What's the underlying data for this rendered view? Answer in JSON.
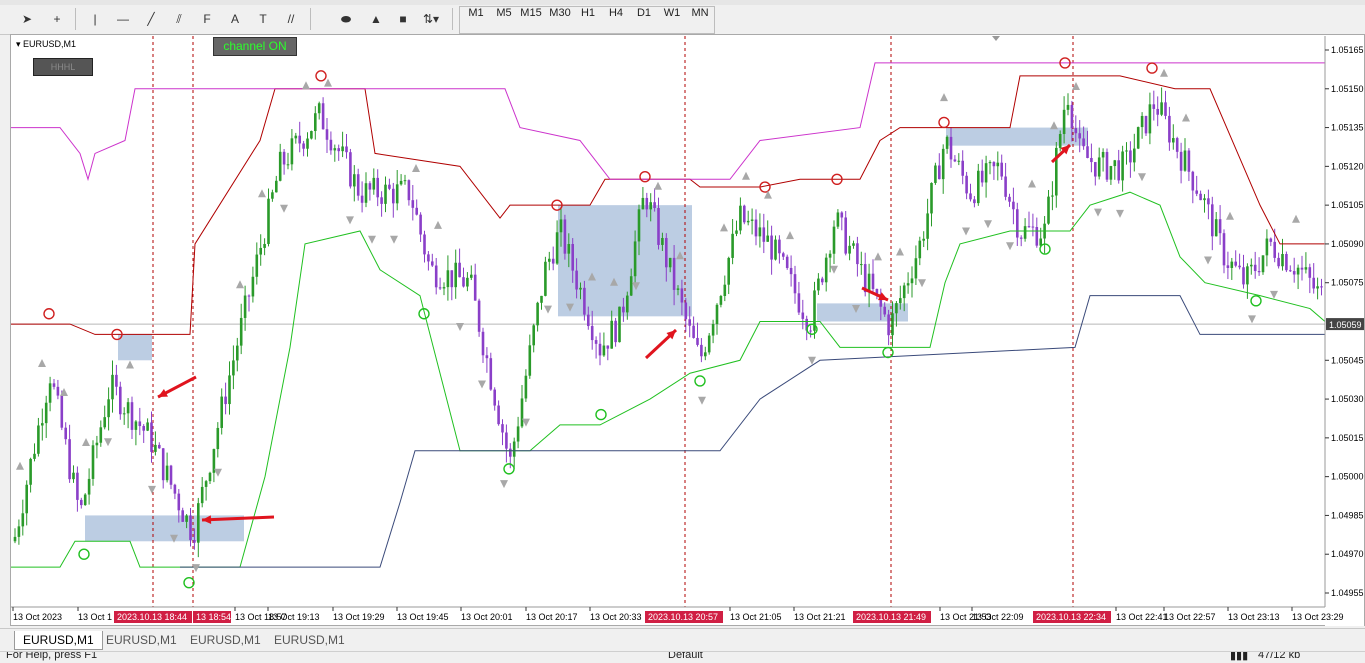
{
  "toolbar": {
    "tools": [
      {
        "name": "cursor-icon",
        "glyph": "➤"
      },
      {
        "name": "crosshair-icon",
        "glyph": "+"
      },
      {
        "name": "vertical-line-icon",
        "glyph": "|"
      },
      {
        "name": "horizontal-line-icon",
        "glyph": "—"
      },
      {
        "name": "trendline-icon",
        "glyph": "╱"
      },
      {
        "name": "channel-icon",
        "glyph": "⫽"
      },
      {
        "name": "fibonacci-icon",
        "glyph": "F"
      },
      {
        "name": "text-icon",
        "glyph": "A"
      },
      {
        "name": "text-label-icon",
        "glyph": "T"
      },
      {
        "name": "gann-icon",
        "glyph": "//"
      },
      {
        "name": "ellipse-icon",
        "glyph": "⬬"
      },
      {
        "name": "triangle-icon",
        "glyph": "▲"
      },
      {
        "name": "rectangle-icon",
        "glyph": "■"
      },
      {
        "name": "arrows-dropdown-icon",
        "glyph": "⇅▾"
      }
    ],
    "timeframes": [
      "M1",
      "M5",
      "M15",
      "M30",
      "H1",
      "H4",
      "D1",
      "W1",
      "MN"
    ]
  },
  "chart": {
    "symbol_label": "EURUSD,M1",
    "channel_button": "channel ON",
    "mini_button": "HHHL",
    "current_price": "1.05059",
    "price_axis": [
      "1.05165",
      "1.05150",
      "1.05135",
      "1.05120",
      "1.05105",
      "1.05090",
      "1.05075",
      "1.05059",
      "1.05045",
      "1.05030",
      "1.05015",
      "1.05000",
      "1.04985",
      "1.04970",
      "1.04955"
    ],
    "time_axis": [
      "13 Oct 2023",
      "13 Oct 1",
      "13 Oct 18:57",
      "13 Oct 19:13",
      "13 Oct 19:29",
      "13 Oct 19:45",
      "13 Oct 20:01",
      "13 Oct 20:17",
      "13 Oct 20:33",
      "13 Oct 21:05",
      "13 Oct 21:21",
      "13 Oct 21:53",
      "13 Oct 22:09",
      "13 Oct 22:41",
      "13 Oct 22:57",
      "13 Oct 23:13",
      "13 Oct 23:29"
    ],
    "time_highlights": [
      "2023.10.13 18:44",
      "13 18:54",
      "2023.10.13 20:57",
      "2023.10.13 21:49",
      "2023.10.13 22:34"
    ],
    "colors": {
      "bull": "#2a9a2a",
      "bear": "#8a3fc8",
      "upper_channel": "#b00000",
      "lower_channel": "#20c020",
      "magenta_line": "#cc33cc",
      "navy_line": "#3a4a7a",
      "zone": "#b0c4de",
      "arrow": "#e0141e",
      "highlight": "#d01f44"
    }
  },
  "tabs": [
    "EURUSD,M1",
    "EURUSD,M1",
    "EURUSD,M1",
    "EURUSD,M1"
  ],
  "status": {
    "help": "For Help, press F1",
    "profile": "Default",
    "traffic": "47/12 kb"
  }
}
